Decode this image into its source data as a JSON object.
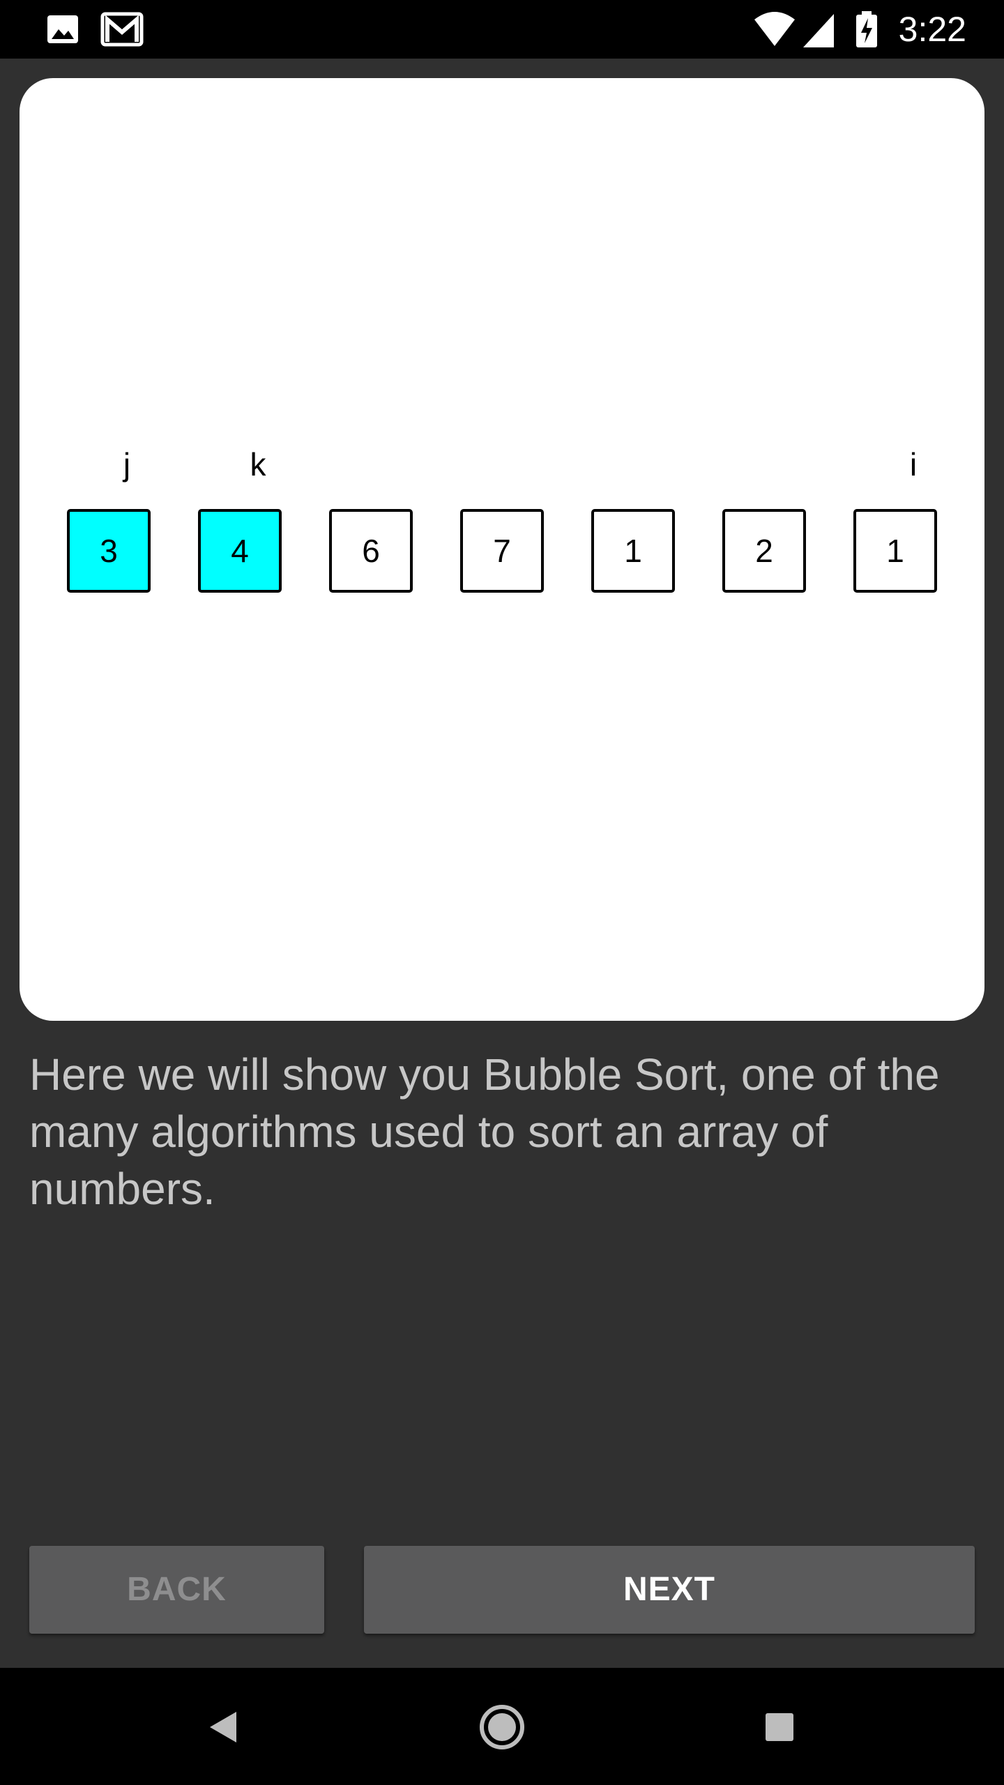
{
  "status_bar": {
    "time": "3:22",
    "left_icons": [
      "image-notification-icon",
      "gmail-icon"
    ],
    "right_icons": [
      "wifi-icon",
      "cell-signal-icon",
      "battery-charging-icon"
    ]
  },
  "visualization": {
    "cells": [
      {
        "value": "3",
        "highlighted": true
      },
      {
        "value": "4",
        "highlighted": true
      },
      {
        "value": "6",
        "highlighted": false
      },
      {
        "value": "7",
        "highlighted": false
      },
      {
        "value": "1",
        "highlighted": false
      },
      {
        "value": "2",
        "highlighted": false
      },
      {
        "value": "1",
        "highlighted": false
      }
    ],
    "pointers": [
      {
        "label": "j",
        "index": 0
      },
      {
        "label": "k",
        "index": 1
      },
      {
        "label": "i",
        "index": 6
      }
    ],
    "highlight_color": "#00ffff"
  },
  "description": "Here we will show you Bubble Sort, one of the many algorithms used to sort an array of numbers.",
  "buttons": {
    "back": {
      "label": "BACK",
      "enabled": false
    },
    "next": {
      "label": "NEXT",
      "enabled": true
    }
  },
  "nav_bar": {
    "icons": [
      "back-triangle-icon",
      "home-circle-icon",
      "recents-square-icon"
    ]
  }
}
